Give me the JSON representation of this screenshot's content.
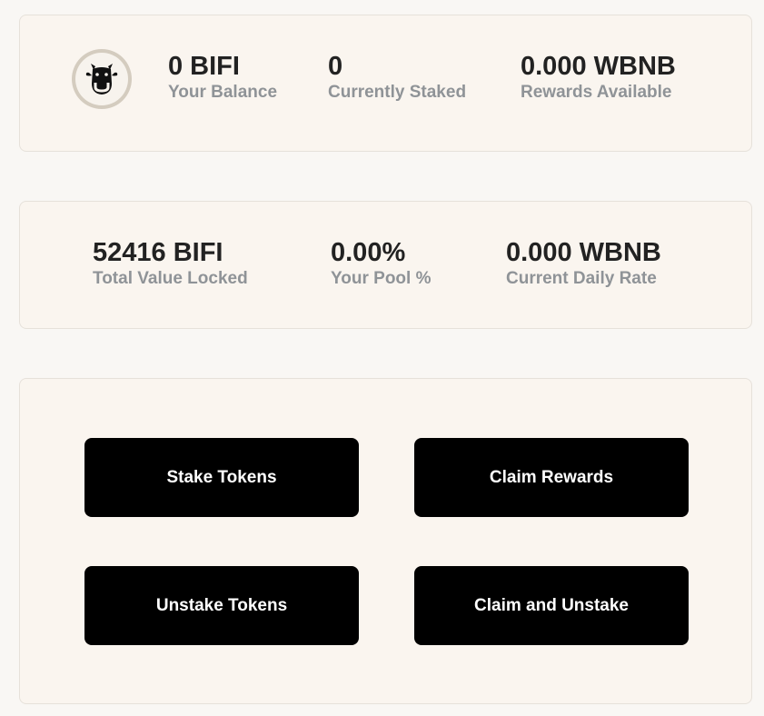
{
  "user_stats": {
    "logo": "bifi-cow-logo",
    "balance": {
      "value": "0 BIFI",
      "label": "Your Balance"
    },
    "staked": {
      "value": "0",
      "label": "Currently Staked"
    },
    "rewards": {
      "value": "0.000 WBNB",
      "label": "Rewards Available"
    }
  },
  "pool_stats": {
    "tvl": {
      "value": "52416 BIFI",
      "label": "Total Value Locked"
    },
    "pool_pct": {
      "value": "0.00%",
      "label": "Your Pool %"
    },
    "daily_rate": {
      "value": "0.000 WBNB",
      "label": "Current Daily Rate"
    }
  },
  "actions": {
    "stake": "Stake Tokens",
    "claim": "Claim Rewards",
    "unstake": "Unstake Tokens",
    "claim_unstake": "Claim and Unstake"
  },
  "colors": {
    "page_bg": "#f9f7f4",
    "card_bg": "#faf5ef",
    "button_bg": "#000000",
    "value_text": "#222222",
    "label_text": "#8f9397"
  }
}
